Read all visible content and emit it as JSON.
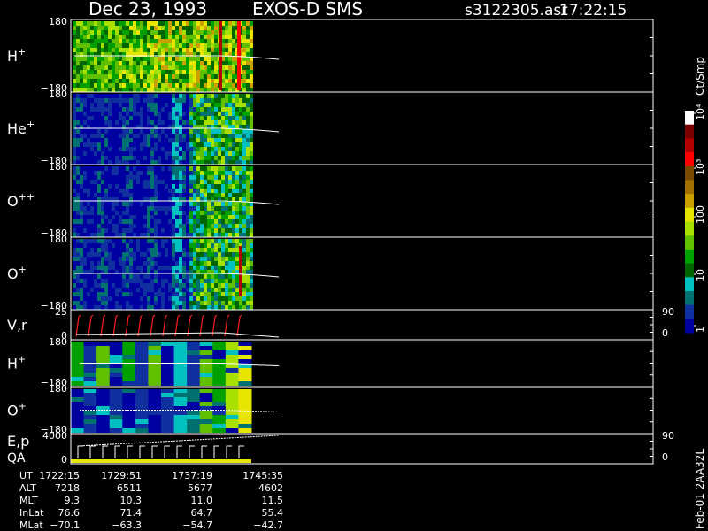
{
  "header": {
    "date": "Dec 23, 1993",
    "instrument": "EXOS-D SMS",
    "file": "s3122305.asr",
    "time": "17:22:15"
  },
  "colorbar": {
    "unit_label": "Ct/Smp",
    "tick_labels": [
      "10⁴",
      "10³",
      "100",
      "10",
      "1"
    ],
    "colors": [
      "#ffffff",
      "#7a0000",
      "#b30000",
      "#ff0000",
      "#7a4a00",
      "#a07000",
      "#c8a000",
      "#e6e600",
      "#a8e000",
      "#60c000",
      "#00a000",
      "#006400",
      "#00c0c0",
      "#007070",
      "#1030a0",
      "#0000a0"
    ]
  },
  "chart_data": {
    "type": "heatmap",
    "panels": [
      {
        "name": "H⁺",
        "sup": "+",
        "base": "H",
        "ytop": "180",
        "ybottom": "−180",
        "style": "ion_bright"
      },
      {
        "name": "He⁺",
        "sup": "+",
        "base": "He",
        "ytop": "180",
        "ybottom": "−180",
        "style": "ion_blue"
      },
      {
        "name": "O⁺⁺",
        "sup": "++",
        "base": "O",
        "ytop": "180",
        "ybottom": "−180",
        "style": "ion_blue"
      },
      {
        "name": "O⁺",
        "sup": "+",
        "base": "O",
        "ytop": "180",
        "ybottom": "−180",
        "style": "ion_blue"
      },
      {
        "name": "V,r",
        "sup": "",
        "base": "V,r",
        "ytop": "25",
        "ybottom": "0",
        "right_top": "90",
        "right_bottom": "0",
        "style": "line"
      },
      {
        "name": "H⁺",
        "sup": "+",
        "base": "H",
        "ytop": "180",
        "ybottom": "−180",
        "style": "bands"
      },
      {
        "name": "O⁺",
        "sup": "+",
        "base": "O",
        "ytop": "180",
        "ybottom": "−180",
        "style": "bands2"
      },
      {
        "name": "E,p",
        "sup": "",
        "base": "E,p",
        "base2": "QA",
        "ytop": "4000",
        "ybottom": "0",
        "right_top": "90",
        "right_bottom": "0",
        "style": "line2"
      }
    ],
    "time_axis": {
      "row_labels": [
        "UT",
        "ALT",
        "MLT",
        "InLat",
        "MLat"
      ],
      "columns": [
        {
          "UT": "1722:15",
          "ALT": "7218",
          "MLT": "9.3",
          "InLat": "76.6",
          "MLat": "−70.1"
        },
        {
          "UT": "1729:51",
          "ALT": "6511",
          "MLT": "10.3",
          "InLat": "71.4",
          "MLat": "−63.3"
        },
        {
          "UT": "1737:19",
          "ALT": "5677",
          "MLT": "11.0",
          "InLat": "64.7",
          "MLat": "−54.7"
        },
        {
          "UT": "1745:35",
          "ALT": "4602",
          "MLT": "11.5",
          "InLat": "55.4",
          "MLat": "−42.7"
        }
      ]
    }
  },
  "footer": {
    "stamp": "Feb-01 2AA32L"
  }
}
